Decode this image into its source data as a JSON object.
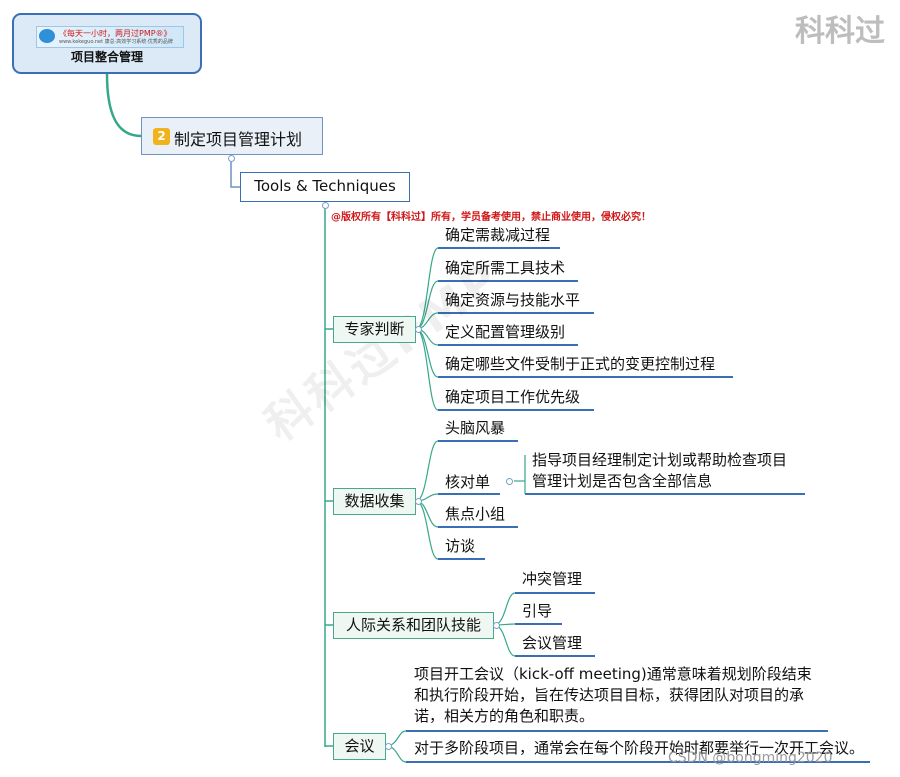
{
  "root": {
    "logo_slogan": "《每天一小时，两月过PMP®》",
    "logo_sub": "www.kekeguo.net 康总·高效学习系统·优秀的品牌",
    "title": "项目整合管理"
  },
  "process": {
    "number": "2",
    "title": "制定项目管理计划"
  },
  "tools_node": "Tools & Techniques",
  "copyright": "@版权所有【科科过】所有，学员备考使用，禁止商业使用，侵权必究！",
  "categories": {
    "expert": {
      "label": "专家判断",
      "items": [
        "确定需裁减过程",
        "确定所需工具技术",
        "确定资源与技能水平",
        "定义配置管理级别",
        "确定哪些文件受制于正式的变更控制过程",
        "确定项目工作优先级"
      ]
    },
    "data": {
      "label": "数据收集",
      "items": [
        "头脑风暴",
        "核对单",
        "焦点小组",
        "访谈"
      ],
      "checklist_note": [
        "指导项目经理制定计划或帮助检查项目",
        "管理计划是否包含全部信息"
      ]
    },
    "interpersonal": {
      "label": "人际关系和团队技能",
      "items": [
        "冲突管理",
        "引导",
        "会议管理"
      ]
    },
    "meeting": {
      "label": "会议",
      "notes": [
        [
          "项目开工会议（kick-off meeting)通常意味着规划阶段结束",
          "和执行阶段开始，旨在传达项目目标，获得团队对项目的承",
          "诺，相关方的角色和职责。"
        ],
        [
          "对于多阶段项目，通常会在每个阶段开始时都要举行一次开工会议。"
        ]
      ]
    }
  },
  "watermark": "科科过",
  "background_mark": "科科过PMP",
  "credit": "CSDN @bongming2020",
  "colors": {
    "root_border": "#3a6fb6",
    "link_green": "#36a88a",
    "leaf_underline": "#3a6fb6",
    "copyright_red": "#d01818",
    "number_badge": "#f2b21c"
  }
}
